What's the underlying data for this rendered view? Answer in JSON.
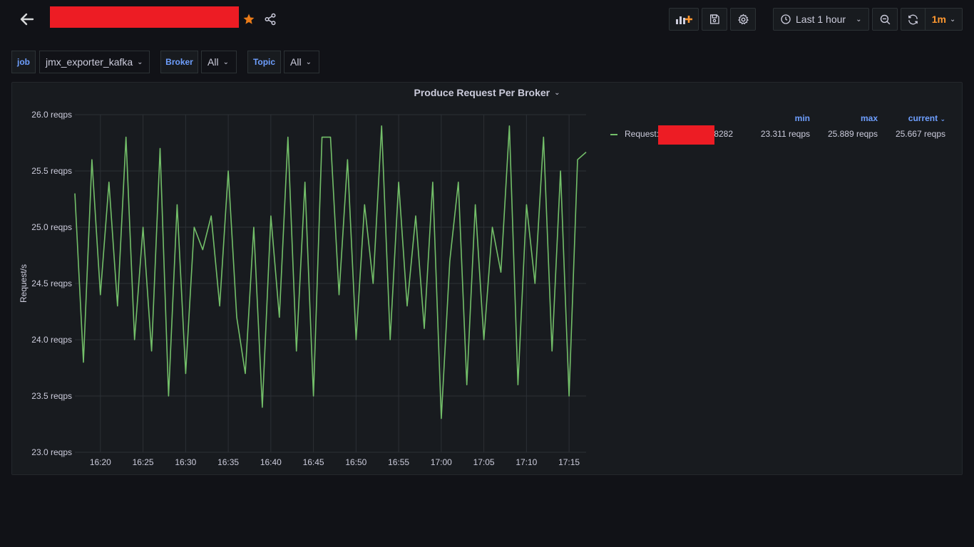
{
  "header": {
    "back_icon": "arrow-left-icon",
    "star_icon": "star-icon",
    "share_icon": "share-icon",
    "add_panel_icon": "add-panel-icon",
    "save_icon": "save-icon",
    "settings_icon": "gear-icon",
    "clock_icon": "clock-icon",
    "time_range": "Last 1 hour",
    "zoom_out_icon": "zoom-out-icon",
    "refresh_icon": "refresh-icon",
    "refresh_interval": "1m",
    "accent_color": "#ff9830"
  },
  "variables": [
    {
      "label": "job",
      "value": "jmx_exporter_kafka"
    },
    {
      "label": "Broker",
      "value": "All"
    },
    {
      "label": "Topic",
      "value": "All"
    }
  ],
  "panel": {
    "title": "Produce Request Per Broker",
    "legend": {
      "headers": {
        "min": "min",
        "max": "max",
        "current": "current"
      },
      "series": [
        {
          "prefix": "Request:",
          "suffix": ":8282",
          "min": "23.311 reqps",
          "max": "25.889 reqps",
          "current": "25.667 reqps",
          "color": "#73bf69"
        }
      ]
    }
  },
  "chart_data": {
    "type": "line",
    "ylabel": "Request/s",
    "y_ticks": [
      "26.0 reqps",
      "25.5 reqps",
      "25.0 reqps",
      "24.5 reqps",
      "24.0 reqps",
      "23.5 reqps",
      "23.0 reqps"
    ],
    "x_ticks": [
      "16:20",
      "16:25",
      "16:30",
      "16:35",
      "16:40",
      "16:45",
      "16:50",
      "16:55",
      "17:00",
      "17:05",
      "17:10",
      "17:15"
    ],
    "ylim": [
      23.0,
      26.0
    ],
    "xlim": [
      "16:17",
      "17:17"
    ],
    "grid": true,
    "series": [
      {
        "name": "Request",
        "color": "#73bf69",
        "x": [
          "16:17",
          "16:18",
          "16:19",
          "16:20",
          "16:21",
          "16:22",
          "16:23",
          "16:24",
          "16:25",
          "16:26",
          "16:27",
          "16:28",
          "16:29",
          "16:30",
          "16:31",
          "16:32",
          "16:33",
          "16:34",
          "16:35",
          "16:36",
          "16:37",
          "16:38",
          "16:39",
          "16:40",
          "16:41",
          "16:42",
          "16:43",
          "16:44",
          "16:45",
          "16:46",
          "16:47",
          "16:48",
          "16:49",
          "16:50",
          "16:51",
          "16:52",
          "16:53",
          "16:54",
          "16:55",
          "16:56",
          "16:57",
          "16:58",
          "16:59",
          "17:00",
          "17:01",
          "17:02",
          "17:03",
          "17:04",
          "17:05",
          "17:06",
          "17:07",
          "17:08",
          "17:09",
          "17:10",
          "17:11",
          "17:12",
          "17:13",
          "17:14",
          "17:15",
          "17:16",
          "17:17"
        ],
        "values": [
          25.3,
          23.8,
          25.6,
          24.4,
          25.4,
          24.3,
          25.8,
          24.0,
          25.0,
          23.9,
          25.7,
          23.5,
          25.2,
          23.7,
          25.0,
          24.8,
          25.1,
          24.3,
          25.5,
          24.2,
          23.7,
          25.0,
          23.4,
          25.1,
          24.2,
          25.8,
          23.9,
          25.4,
          23.5,
          25.8,
          25.8,
          24.4,
          25.6,
          24.0,
          25.2,
          24.5,
          25.9,
          24.0,
          25.4,
          24.3,
          25.1,
          24.1,
          25.4,
          23.3,
          24.7,
          25.4,
          23.6,
          25.2,
          24.0,
          25.0,
          24.6,
          25.9,
          23.6,
          25.2,
          24.5,
          25.8,
          23.9,
          25.5,
          23.5,
          25.6,
          25.667
        ]
      }
    ]
  }
}
